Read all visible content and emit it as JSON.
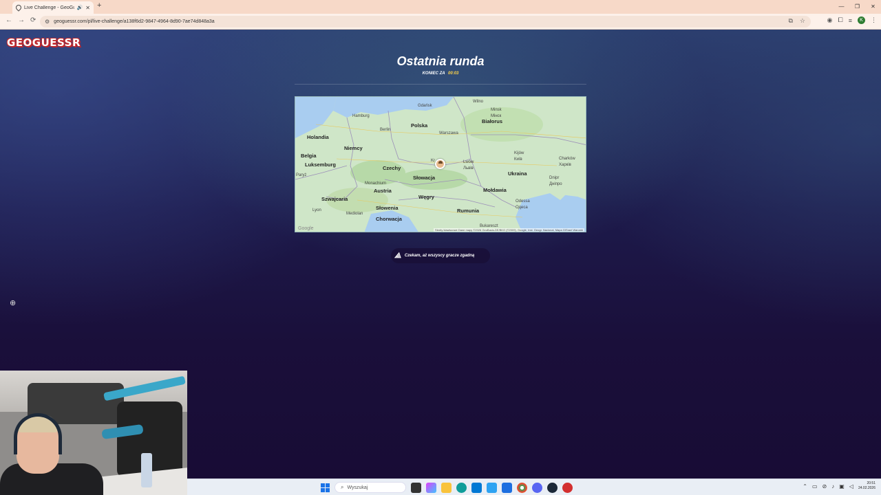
{
  "browser": {
    "tab_title": "Live Challenge - GeoGuessr",
    "tab_audio_icon": "speaker-icon",
    "url": "geoguessr.com/pl/live-challenge/a138f6d2-9847-4964-8d90-7ae74d848a3a",
    "window_controls": [
      "—",
      "❐",
      "✕"
    ]
  },
  "page": {
    "logo": "GEOGUESSR",
    "title": "Ostatnia runda",
    "countdown_label": "KONIEC ZA",
    "countdown_time": "00:03",
    "waiting_text": "Czekam, aż wszyscy gracze zgadną"
  },
  "map": {
    "countries": [
      {
        "name": "Polska"
      },
      {
        "name": "Niemcy"
      },
      {
        "name": "Holandia"
      },
      {
        "name": "Belgia"
      },
      {
        "name": "Luksemburg"
      },
      {
        "name": "Czechy"
      },
      {
        "name": "Słowacja"
      },
      {
        "name": "Austria"
      },
      {
        "name": "Węgry"
      },
      {
        "name": "Szwajcaria"
      },
      {
        "name": "Słowenia"
      },
      {
        "name": "Chorwacja"
      },
      {
        "name": "Rumunia"
      },
      {
        "name": "Mołdawia"
      },
      {
        "name": "Ukraina"
      },
      {
        "name": "Białorus"
      }
    ],
    "cities": [
      {
        "name": "Gdańsk"
      },
      {
        "name": "Hamburg"
      },
      {
        "name": "Berlin"
      },
      {
        "name": "Warszawa"
      },
      {
        "name": "Wilno"
      },
      {
        "name": "Minsk\nМінск"
      },
      {
        "name": "Kijów\nКиїв"
      },
      {
        "name": "Lwów\nЛьвів"
      },
      {
        "name": "Charków\nХарків"
      },
      {
        "name": "Dnipr\nДніпро"
      },
      {
        "name": "Odessa\nОдеса"
      },
      {
        "name": "Monachium"
      },
      {
        "name": "Paryż"
      },
      {
        "name": "Lyon"
      },
      {
        "name": "Mediolan"
      },
      {
        "name": "Bukareszt"
      },
      {
        "name": "Kr"
      }
    ],
    "google_mark": "Google",
    "footer": "Skróty klawiszowe   Dane mapy ©2026 GeoBasis-DE/BKG (©2009), Google, Inst. Geogr. Nacional, Mapa GISrael   Warunki"
  },
  "taskbar": {
    "search_placeholder": "Wyszukaj",
    "time": "20:51",
    "date": "24.02.2026"
  }
}
